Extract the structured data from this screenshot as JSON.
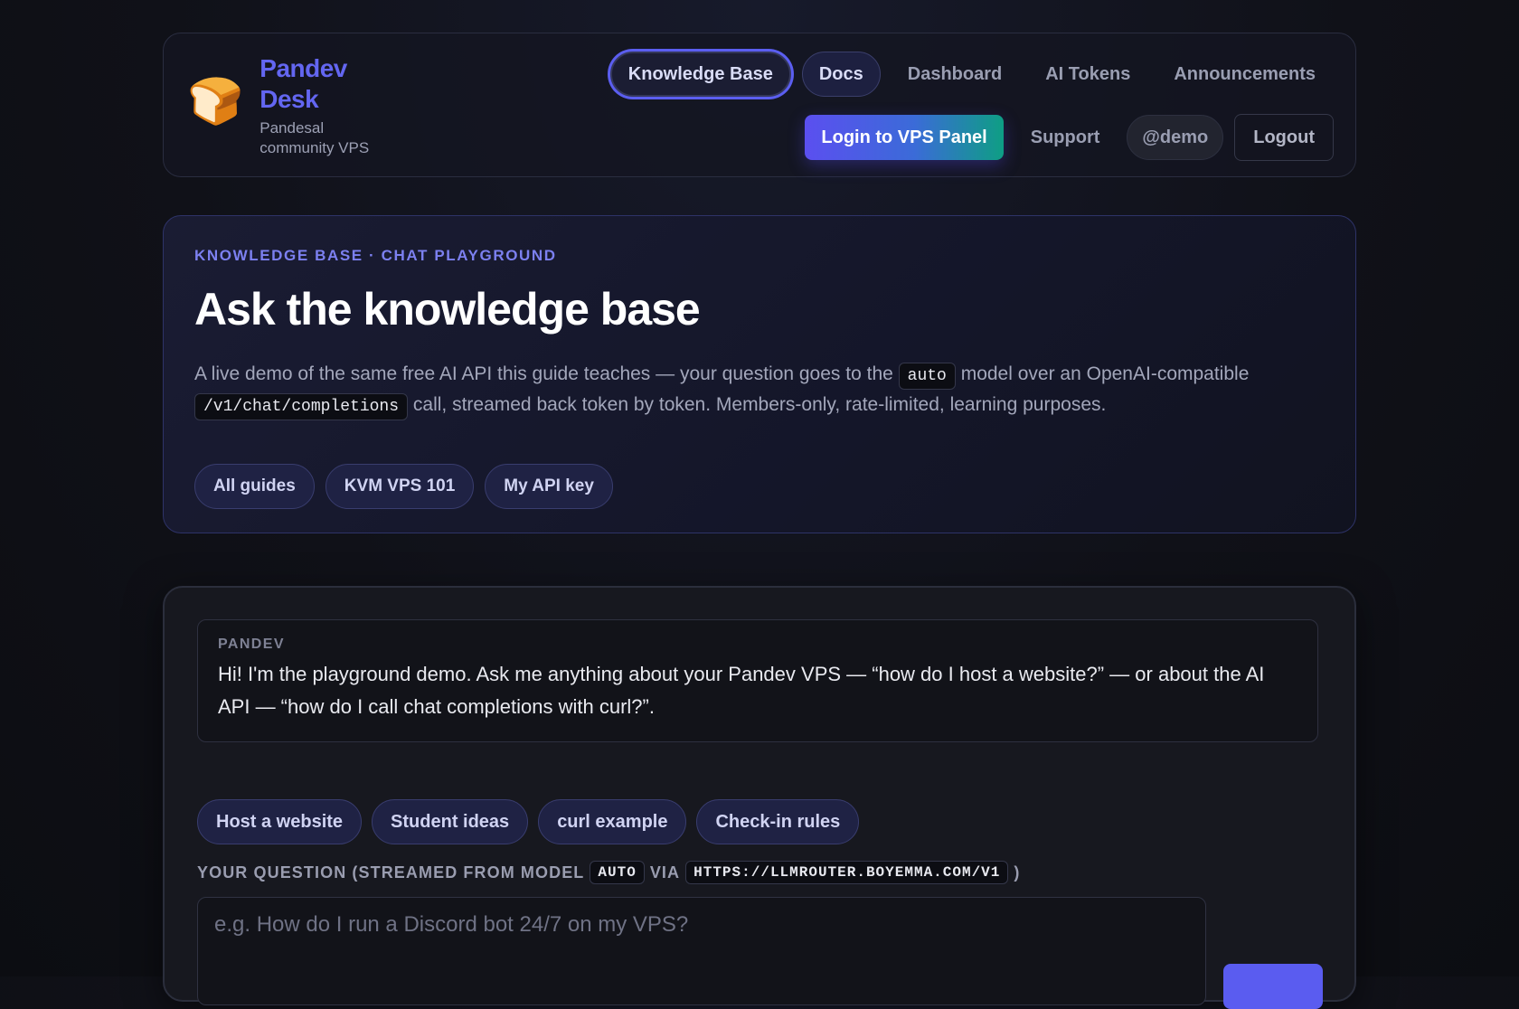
{
  "brand": {
    "logo": "🍞",
    "title": "Pandev Desk",
    "subtitle": "Pandesal community VPS"
  },
  "nav": {
    "knowledge_base": "Knowledge Base",
    "docs": "Docs",
    "dashboard": "Dashboard",
    "ai_tokens": "AI Tokens",
    "announcements": "Announcements",
    "login_vps": "Login to VPS Panel",
    "support": "Support",
    "user": "@demo",
    "logout": "Logout"
  },
  "hero": {
    "eyebrow": "KNOWLEDGE BASE · CHAT PLAYGROUND",
    "title": "Ask the knowledge base",
    "desc_part1": "A live demo of the same free AI API this guide teaches — your question goes to the",
    "desc_code1": "auto",
    "desc_part2": "model over an OpenAI-compatible",
    "desc_code2": "/v1/chat/completions",
    "desc_part3": "call, streamed back token by token. Members-only, rate-limited, learning purposes.",
    "pills": [
      "All guides",
      "KVM VPS 101",
      "My API key"
    ]
  },
  "playground": {
    "message_author": "PANDEV",
    "message_text": "Hi! I'm the playground demo. Ask me anything about your Pandev VPS — “how do I host a website?” — or about the AI API — “how do I call chat completions with curl?”.",
    "suggestions": [
      "Host a website",
      "Student ideas",
      "curl example",
      "Check-in rules"
    ],
    "label_part1": "YOUR QUESTION (STREAMED FROM MODEL",
    "label_model": "AUTO",
    "label_part2": "VIA",
    "label_url": "HTTPS://LLMROUTER.BOYEMMA.COM/V1",
    "label_part3": ")",
    "input_placeholder": "e.g. How do I run a Discord bot 24/7 on my VPS?"
  },
  "colors": {
    "accent": "#6366f1",
    "page_bg": "#101118",
    "gradient_start": "#5b4ff0",
    "gradient_end": "#0e9e84"
  }
}
